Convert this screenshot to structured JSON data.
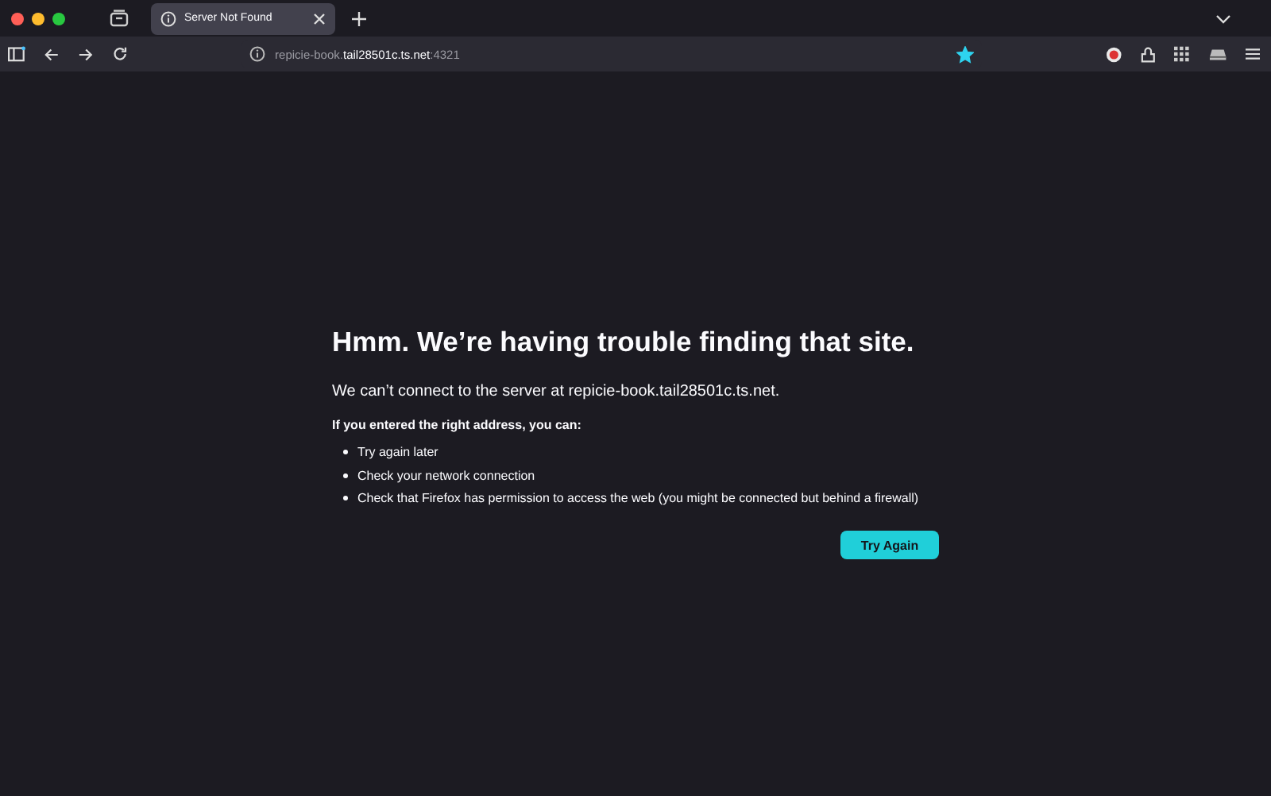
{
  "tabs": [
    {
      "title": "Server Not Found",
      "selected": true
    }
  ],
  "url": {
    "prefix": "repicie-book.",
    "domain": "tail28501c.ts.net",
    "suffix": ":4321"
  },
  "bookmarked": true,
  "error": {
    "title": "Hmm. We’re having trouble finding that site.",
    "message": "We can’t connect to the server at repicie-book.tail28501c.ts.net.",
    "hint": "If you entered the right address, you can:",
    "suggestions": [
      "Try again later",
      "Check your network connection",
      "Check that Firefox has permission to access the web (you might be connected but behind a firewall)"
    ],
    "button": "Try Again"
  }
}
